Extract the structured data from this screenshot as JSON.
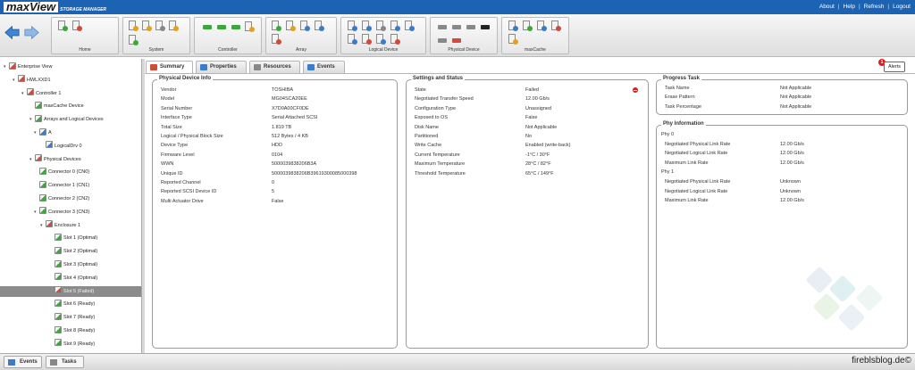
{
  "app": {
    "logo": "maxView",
    "logo_sub": "STORAGE MANAGER"
  },
  "top_links": [
    "About",
    "Help",
    "Refresh",
    "Logout"
  ],
  "toolbar": {
    "groups": [
      "Home",
      "System",
      "Controller",
      "Array",
      "Logical Device",
      "Physical Device",
      "maxCache"
    ]
  },
  "tree": [
    {
      "label": "Enterprise View",
      "level": 0,
      "icon": "enterprise-icon"
    },
    {
      "label": "HWLXXD1",
      "level": 1,
      "icon": "server-icon"
    },
    {
      "label": "Controller 1",
      "level": 2,
      "icon": "controller-icon"
    },
    {
      "label": "maxCache Device",
      "level": 3,
      "icon": "maxcache-icon"
    },
    {
      "label": "Arrays and Logical Devices",
      "level": 3,
      "icon": "arrays-icon"
    },
    {
      "label": "A",
      "level": 4,
      "icon": "array-icon"
    },
    {
      "label": "LogicalDrv 0",
      "level": 5,
      "icon": "logical-drive-icon"
    },
    {
      "label": "Physical Devices",
      "level": 3,
      "icon": "physical-devices-icon"
    },
    {
      "label": "Connector 0 (CN0)",
      "level": 4,
      "icon": "connector-icon"
    },
    {
      "label": "Connector 1 (CN1)",
      "level": 4,
      "icon": "connector-icon"
    },
    {
      "label": "Connector 2 (CN2)",
      "level": 4,
      "icon": "connector-icon"
    },
    {
      "label": "Connector 3 (CN3)",
      "level": 4,
      "icon": "connector-icon"
    },
    {
      "label": "Enclosure 1",
      "level": 5,
      "icon": "enclosure-icon"
    },
    {
      "label": "Slot 1 (Optimal)",
      "level": 6,
      "icon": "drive-icon"
    },
    {
      "label": "Slot 2 (Optimal)",
      "level": 6,
      "icon": "drive-icon"
    },
    {
      "label": "Slot 3 (Optimal)",
      "level": 6,
      "icon": "drive-icon"
    },
    {
      "label": "Slot 4 (Optimal)",
      "level": 6,
      "icon": "drive-icon"
    },
    {
      "label": "Slot 5 (Failed)",
      "level": 6,
      "icon": "drive-icon",
      "selected": true
    },
    {
      "label": "Slot 6 (Ready)",
      "level": 6,
      "icon": "drive-icon"
    },
    {
      "label": "Slot 7 (Ready)",
      "level": 6,
      "icon": "drive-icon"
    },
    {
      "label": "Slot 8 (Ready)",
      "level": 6,
      "icon": "drive-icon"
    },
    {
      "label": "Slot 9 (Ready)",
      "level": 6,
      "icon": "drive-icon"
    }
  ],
  "tabs": [
    {
      "label": "Summary",
      "active": true
    },
    {
      "label": "Properties"
    },
    {
      "label": "Resources"
    },
    {
      "label": "Events"
    }
  ],
  "alerts": {
    "label": "Alerts",
    "count": "1"
  },
  "physical_device_info": {
    "title": "Physical Device Info",
    "rows": [
      [
        "Vendor",
        "TOSHIBA"
      ],
      [
        "Model",
        "MG04SCA20EE"
      ],
      [
        "Serial Number",
        "X7D0A00CF0DE"
      ],
      [
        "Interface Type",
        "Serial Attached SCSI"
      ],
      [
        "Total Size",
        "1.819 TB"
      ],
      [
        "Logical / Physical Block Size",
        "512 Bytes / 4 KB"
      ],
      [
        "Device Type",
        "HDD"
      ],
      [
        "Firmware Level",
        "0104"
      ],
      [
        "WWN",
        "5000039838206B3A"
      ],
      [
        "Unique ID",
        "5000039838206B39619300085000398"
      ],
      [
        "Reported Channel",
        "0"
      ],
      [
        "Reported SCSI Device ID",
        "5"
      ],
      [
        "Multi Actuator Drive",
        "False"
      ]
    ]
  },
  "settings_status": {
    "title": "Settings and Status",
    "rows": [
      [
        "State",
        "Failed"
      ],
      [
        "Negotiated Transfer Speed",
        "12.00 Gb/s"
      ],
      [
        "Configuration Type",
        "Unassigned"
      ],
      [
        "Exposed to OS",
        "False"
      ],
      [
        "Disk Name",
        "Not Applicable"
      ],
      [
        "Partitioned",
        "No"
      ],
      [
        "Write Cache",
        "Enabled (write-back)"
      ],
      [
        "Current Temperature",
        "-1°C / 30°F"
      ],
      [
        "Maximum Temperature",
        "28°C / 82°F"
      ],
      [
        "Threshold Temperature",
        "65°C / 149°F"
      ]
    ]
  },
  "progress_task": {
    "title": "Progress Task",
    "rows": [
      [
        "Task Name",
        "Not Applicable"
      ],
      [
        "Erase Pattern",
        "Not Applicable"
      ],
      [
        "Task Percentage",
        "Not Applicable"
      ]
    ]
  },
  "phy_information": {
    "title": "Phy Information",
    "phys": [
      {
        "name": "Phy 0",
        "rows": [
          [
            "Negotiated Physical Link Rate",
            "12.00 Gb/s"
          ],
          [
            "Negotiated Logical Link Rate",
            "12.00 Gb/s"
          ],
          [
            "Maximum Link Rate",
            "12.00 Gb/s"
          ]
        ]
      },
      {
        "name": "Phy 1",
        "rows": [
          [
            "Negotiated Physical Link Rate",
            "Unknown"
          ],
          [
            "Negotiated Logical Link Rate",
            "Unknown"
          ],
          [
            "Maximum Link Rate",
            "12.00 Gb/s"
          ]
        ]
      }
    ]
  },
  "bottom_tabs": [
    "Events",
    "Tasks"
  ],
  "watermark": "fireblsblog.de©",
  "colors": {
    "header": "#1c63b4",
    "selected": "#8b8b8b",
    "failed": "#d82020",
    "ok": "#3aa83a"
  }
}
